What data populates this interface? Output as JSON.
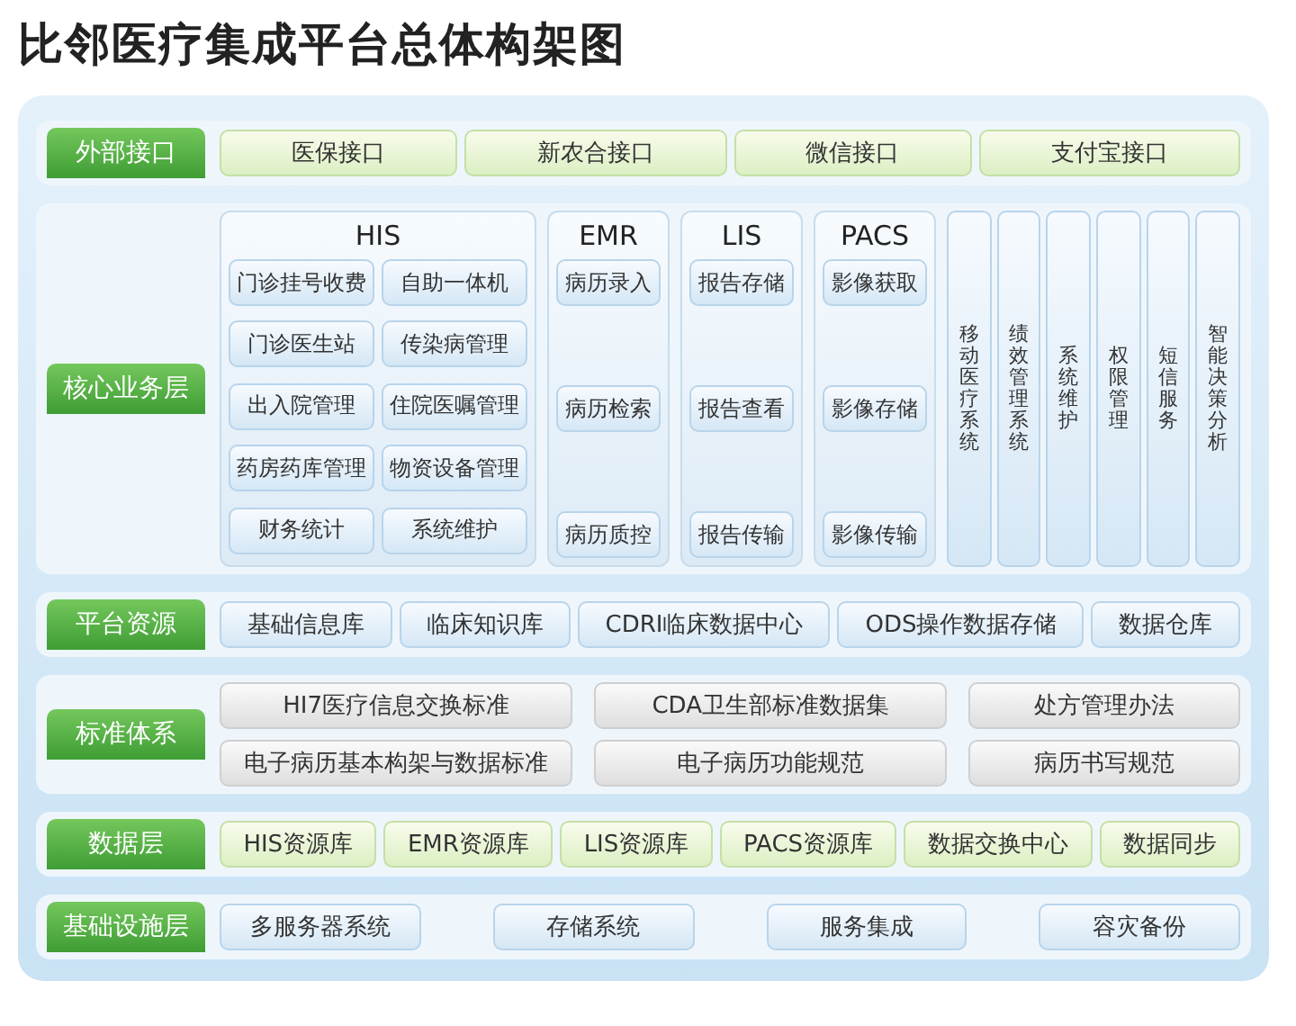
{
  "title": "比邻医疗集成平台总体构架图",
  "layers": [
    {
      "label": "外部接口",
      "kind": "interface",
      "items": [
        "医保接口",
        "新农合接口",
        "微信接口",
        "支付宝接口"
      ]
    },
    {
      "label": "核心业务层",
      "kind": "core",
      "systems": [
        {
          "name": "HIS",
          "kind": "grid",
          "items": [
            "门诊挂号收费",
            "自助一体机",
            "门诊医生站",
            "传染病管理",
            "出入院管理",
            "住院医嘱管理",
            "药房药库管理",
            "物资设备管理",
            "财务统计",
            "系统维护"
          ]
        },
        {
          "name": "EMR",
          "kind": "column",
          "items": [
            "病历录入",
            "病历检索",
            "病历质控"
          ]
        },
        {
          "name": "LIS",
          "kind": "column",
          "items": [
            "报告存储",
            "报告查看",
            "报告传输"
          ]
        },
        {
          "name": "PACS",
          "kind": "column",
          "items": [
            "影像获取",
            "影像存储",
            "影像传输"
          ]
        }
      ],
      "services": [
        "移动医疗系统",
        "绩效管理系统",
        "系统维护",
        "权限管理",
        "短信服务",
        "智能决策分析"
      ]
    },
    {
      "label": "平台资源",
      "kind": "resource",
      "items": [
        "基础信息库",
        "临床知识库",
        "CDRI临床数据中心",
        "ODS操作数据存储",
        "数据仓库"
      ]
    },
    {
      "label": "标准体系",
      "kind": "standard",
      "items": [
        "HI7医疗信息交换标准",
        "CDA卫生部标准数据集",
        "处方管理办法",
        "电子病历基本构架与数据标准",
        "电子病历功能规范",
        "病历书写规范"
      ]
    },
    {
      "label": "数据层",
      "kind": "interface",
      "items": [
        "HIS资源库",
        "EMR资源库",
        "LIS资源库",
        "PACS资源库",
        "数据交换中心",
        "数据同步"
      ]
    },
    {
      "label": "基础设施层",
      "kind": "spaced",
      "items": [
        "多服务器系统",
        "存储系统",
        "服务集成",
        "容灾备份"
      ]
    }
  ]
}
